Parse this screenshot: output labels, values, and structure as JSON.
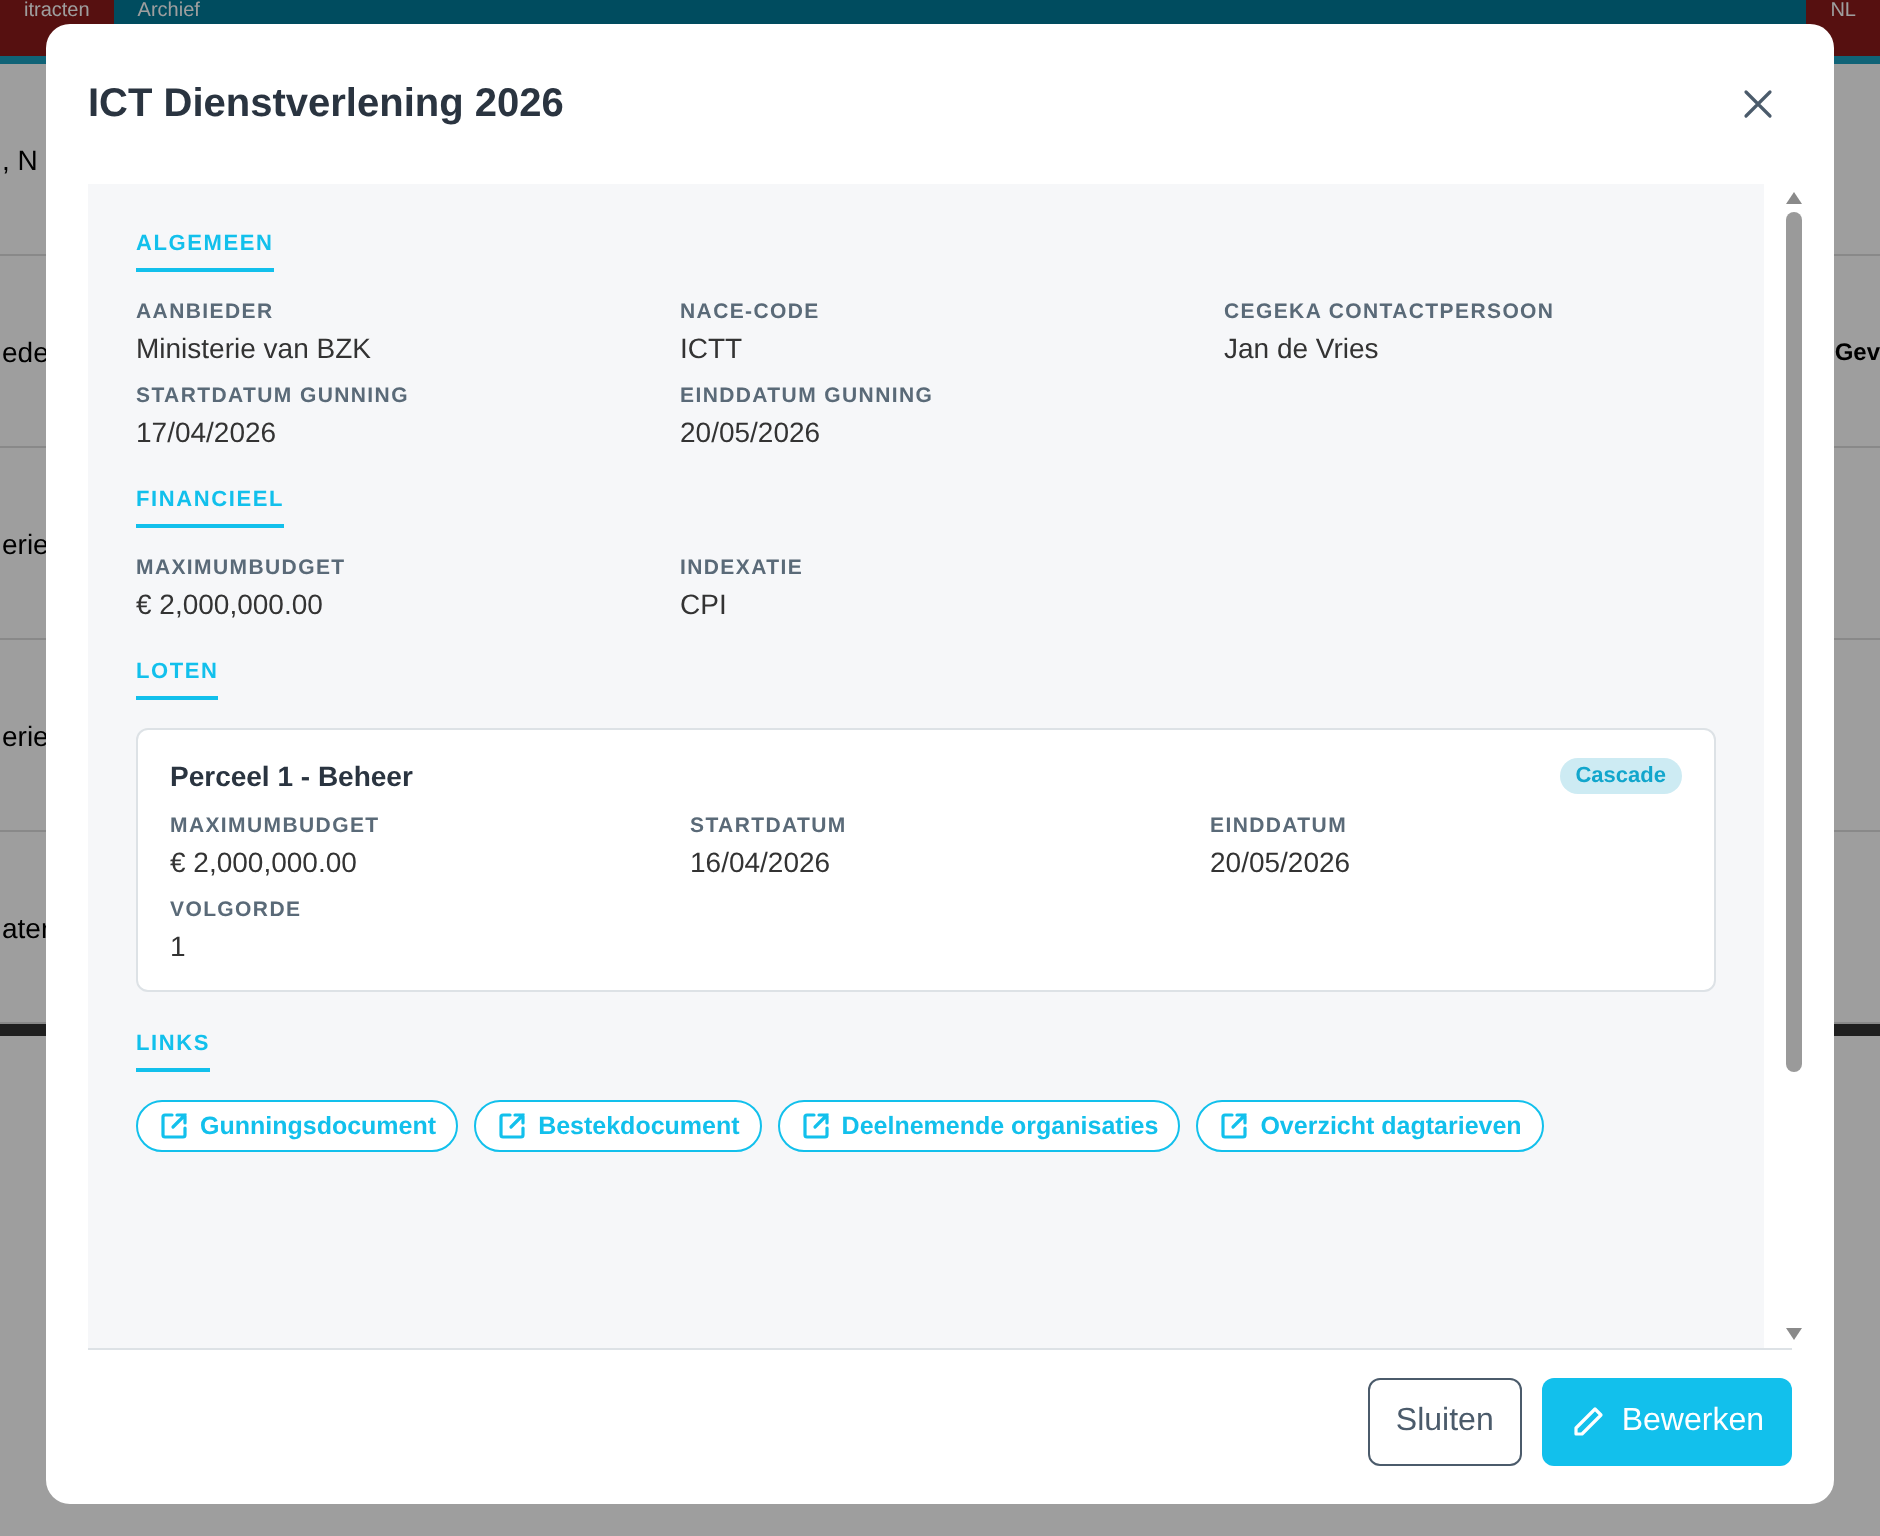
{
  "background": {
    "tabs": [
      {
        "label": "itracten",
        "selected": true
      },
      {
        "label": "Archief",
        "selected": false
      }
    ],
    "language": "NL",
    "rows": [
      {
        "left": ", N",
        "right": ""
      },
      {
        "left": "ede",
        "right": "Gev"
      },
      {
        "left": "erie",
        "right": ""
      },
      {
        "left": "erie",
        "right": ""
      },
      {
        "left": "ater",
        "right": ""
      }
    ]
  },
  "dialog": {
    "title": "ICT Dienstverlening 2026",
    "sections": [
      {
        "kind": "fields",
        "heading": "ALGEMEEN",
        "fields": [
          {
            "label": "AANBIEDER",
            "value": "Ministerie van BZK"
          },
          {
            "label": "NACE-CODE",
            "value": "ICTT"
          },
          {
            "label": "CEGEKA CONTACTPERSOON",
            "value": "Jan de Vries"
          },
          {
            "label": "STARTDATUM GUNNING",
            "value": "17/04/2026"
          },
          {
            "label": "EINDDATUM GUNNING",
            "value": "20/05/2026"
          }
        ]
      },
      {
        "kind": "fields",
        "heading": "FINANCIEEL",
        "fields": [
          {
            "label": "MAXIMUMBUDGET",
            "value": "€ 2,000,000.00"
          },
          {
            "label": "INDEXATIE",
            "value": "CPI"
          }
        ]
      },
      {
        "kind": "lots",
        "heading": "LOTEN",
        "lots": [
          {
            "title": "Perceel 1 - Beheer",
            "badge": "Cascade",
            "fields": [
              {
                "label": "MAXIMUMBUDGET",
                "value": "€ 2,000,000.00"
              },
              {
                "label": "STARTDATUM",
                "value": "16/04/2026"
              },
              {
                "label": "EINDDATUM",
                "value": "20/05/2026"
              },
              {
                "label": "VOLGORDE",
                "value": "1"
              }
            ]
          }
        ]
      },
      {
        "kind": "links",
        "heading": "LINKS",
        "links": [
          "Gunningsdocument",
          "Bestekdocument",
          "Deelnemende organisaties",
          "Overzicht dagtarieven"
        ]
      }
    ],
    "buttons": [
      {
        "kind": "secondary",
        "label": "Sluiten"
      },
      {
        "kind": "primary",
        "label": "Bewerken"
      }
    ]
  }
}
